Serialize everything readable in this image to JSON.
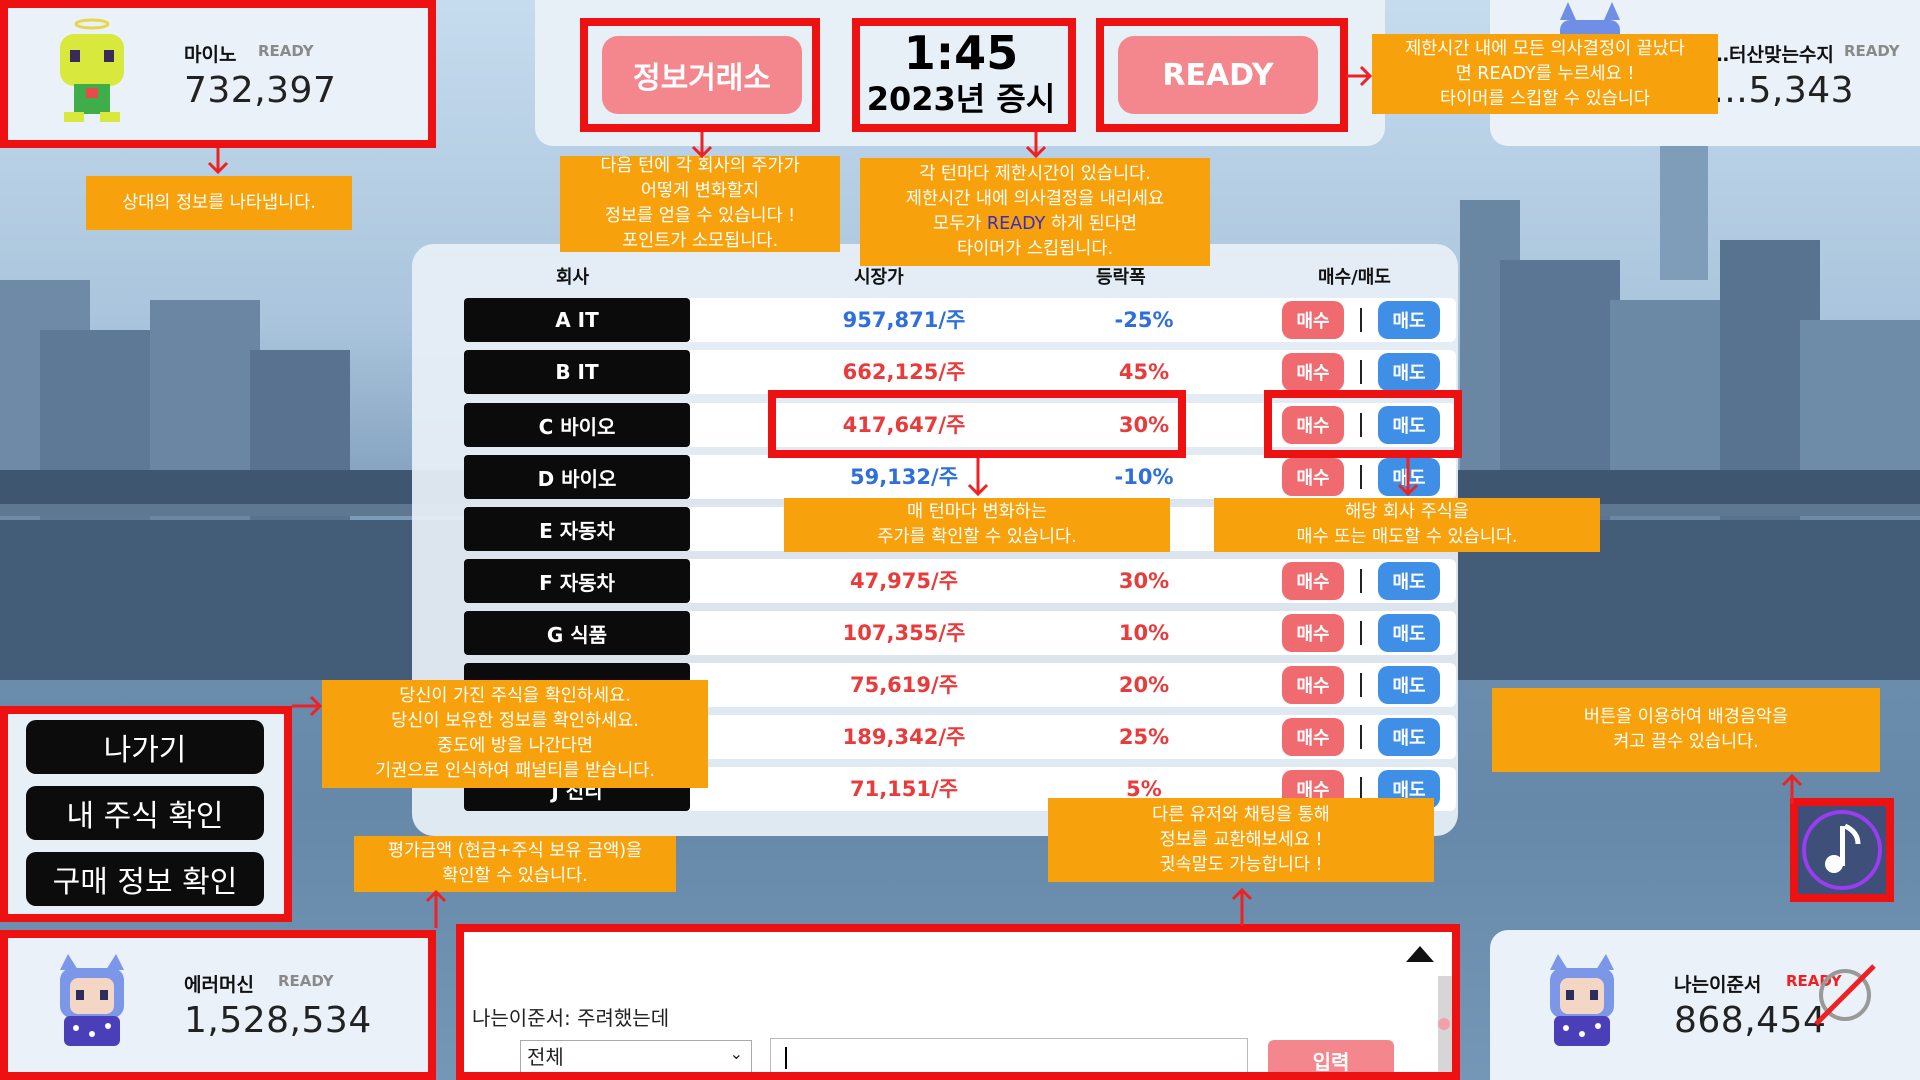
{
  "players": {
    "top_left": {
      "name": "마이노",
      "status": "READY",
      "money": "732,397",
      "avatar": "yellow-angel-character"
    },
    "top_right": {
      "name": "…터산맞는수지",
      "status": "READY",
      "money": "…5,343",
      "avatar": "blue-cat-character"
    },
    "bottom_left": {
      "name": "에러머신",
      "status": "READY",
      "money": "1,528,534",
      "avatar": "blue-cat-character"
    },
    "bottom_right": {
      "name": "나는이준서",
      "status": "READY",
      "money": "868,454",
      "avatar": "blue-cat-character",
      "muted_icon": "slashed-circle-icon"
    }
  },
  "top": {
    "info_exchange_label": "정보거래소",
    "timer": "1:45",
    "session": "2023년 증시",
    "ready_label": "READY"
  },
  "callouts": {
    "opponent_info": "상대의 정보를 나타냅니다.",
    "info_exchange": [
      "다음 턴에 각 회사의 주가가",
      "어떻게 변화할지",
      "정보를 얻을 수 있습니다 !",
      "포인트가 소모됩니다."
    ],
    "timer": [
      "각 턴마다 제한시간이 있습니다.",
      "제한시간 내에 의사결정을 내리세요",
      "모두가",
      "READY",
      "하게 된다면",
      "타이머가 스킵됩니다."
    ],
    "ready": [
      "제한시간 내에 모든 의사결정이 끝났다",
      "면 READY를 누르세요 !",
      "타이머를 스킵할 수 있습니다"
    ],
    "price_change": [
      "매 턴마다 변화하는",
      "주가를 확인할 수 있습니다."
    ],
    "trade": [
      "해당 회사 주식을",
      "매수 또는 매도할 수 있습니다."
    ],
    "menu": [
      "당신이 가진 주식을 확인하세요.",
      "당신이 보유한 정보를 확인하세요.",
      "중도에 방을 나간다면",
      "기권으로 인식하여 패널티를 받습니다."
    ],
    "valuation": [
      "평가금액 (현금+주식 보유 금액)을",
      "확인할 수 있습니다."
    ],
    "chat": [
      "다른 유저와 채팅을 통해",
      "정보를 교환해보세요 !",
      "귓속말도 가능합니다 !"
    ],
    "music": [
      "버튼을 이용하여 배경음악을",
      "켜고 끌수 있습니다."
    ]
  },
  "table": {
    "headers": {
      "company": "회사",
      "price": "시장가",
      "change": "등락폭",
      "trade": "매수/매도"
    },
    "buy_label": "매수",
    "sell_label": "매도",
    "rows": [
      {
        "company": "A IT",
        "price": "957,871/주",
        "change": "-25%",
        "direction": "down"
      },
      {
        "company": "B IT",
        "price": "662,125/주",
        "change": "45%",
        "direction": "up"
      },
      {
        "company": "C 바이오",
        "price": "417,647/주",
        "change": "30%",
        "direction": "up"
      },
      {
        "company": "D 바이오",
        "price": "59,132/주",
        "change": "-10%",
        "direction": "down"
      },
      {
        "company": "E 자동차",
        "price": "",
        "change": "",
        "direction": "up"
      },
      {
        "company": "F 자동차",
        "price": "47,975/주",
        "change": "30%",
        "direction": "up"
      },
      {
        "company": "G 식품",
        "price": "107,355/주",
        "change": "10%",
        "direction": "up"
      },
      {
        "company": "",
        "price": "75,619/주",
        "change": "20%",
        "direction": "up"
      },
      {
        "company": "",
        "price": "189,342/주",
        "change": "25%",
        "direction": "up"
      },
      {
        "company": "J 전리",
        "price": "71,151/주",
        "change": "5%",
        "direction": "up"
      }
    ]
  },
  "menu": {
    "exit": "나가기",
    "my_stocks": "내 주식 확인",
    "purchase_info": "구매 정보 확인"
  },
  "chat": {
    "message_sender": "나는이준서:",
    "message_text": "주려했는데",
    "channel": "전체",
    "send_label": "입력"
  },
  "colors": {
    "up": "#e83b3b",
    "down": "#2f6fdb",
    "callout": "#f7a20c",
    "highlight": "#ee1111",
    "pink": "#f4878e"
  }
}
